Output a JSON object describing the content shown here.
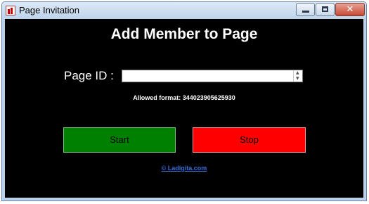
{
  "window": {
    "title": "Page Invitation",
    "close_glyph": "✕"
  },
  "main": {
    "heading": "Add Member to Page",
    "page_id_label": "Page ID :",
    "page_id_value": "",
    "allowed_format": "Allowed format: 344023905625930",
    "start_label": "Start",
    "stop_label": "Stop",
    "link_text": "© Ladigita.com"
  },
  "colors": {
    "start": "#008000",
    "stop": "#ff0000",
    "background": "#000000",
    "link": "#3a6fd8"
  }
}
